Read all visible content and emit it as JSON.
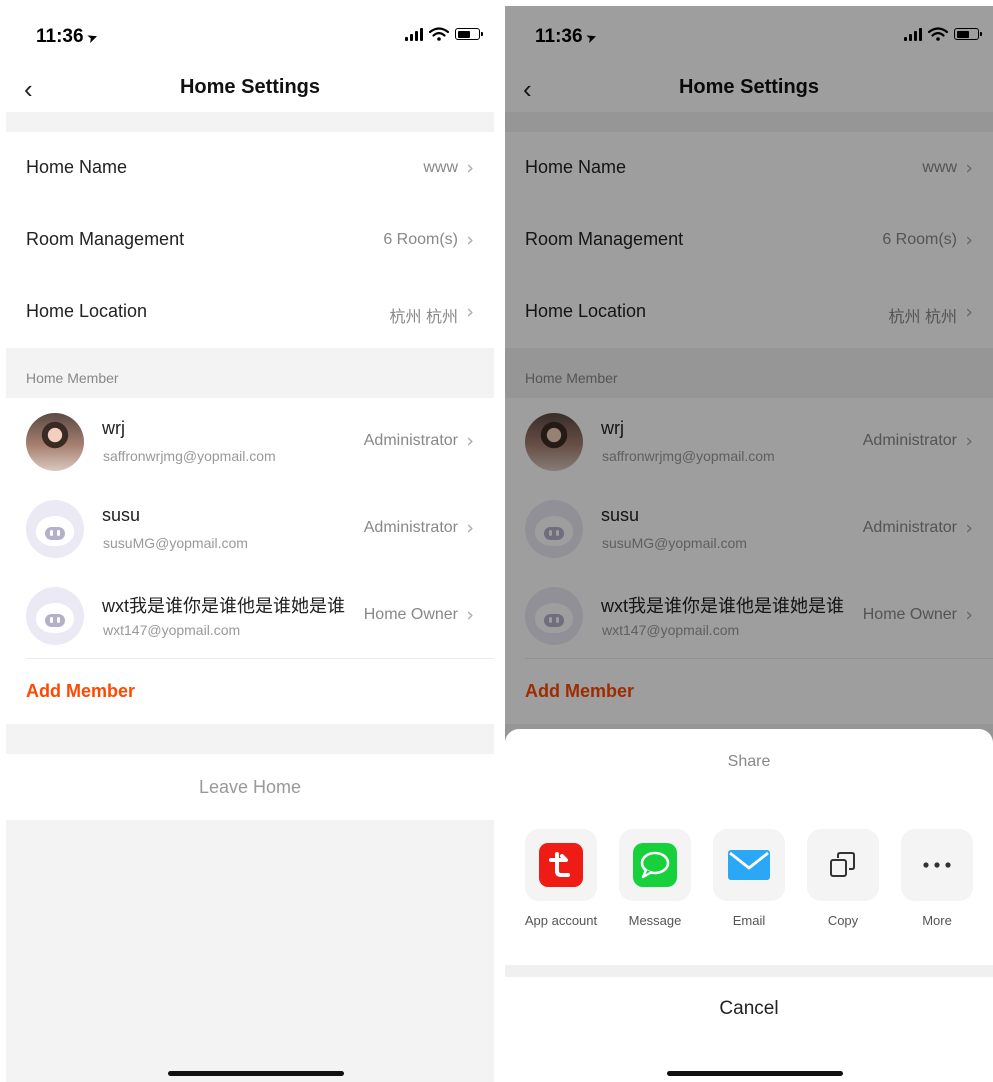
{
  "status_bar": {
    "time": "11:36",
    "location_arrow": "➤"
  },
  "nav": {
    "title": "Home Settings",
    "back_icon": "‹"
  },
  "settings": [
    {
      "label": "Home Name",
      "value": "www"
    },
    {
      "label": "Room Management",
      "value": "6 Room(s)"
    },
    {
      "label": "Home Location",
      "value": "杭州 杭州"
    }
  ],
  "chevron": "›",
  "members_section": {
    "header": "Home Member",
    "add_label": "Add Member"
  },
  "members": [
    {
      "name": "wrj",
      "email": "saffronwrjmg@yopmail.com",
      "role": "Administrator",
      "avatar": "photo"
    },
    {
      "name": "susu",
      "email": "susuMG@yopmail.com",
      "role": "Administrator",
      "avatar": "robot-icon"
    },
    {
      "name": "wxt我是谁你是谁他是谁她是谁",
      "email": "wxt147@yopmail.com",
      "role": "Home Owner",
      "avatar": "robot-icon"
    }
  ],
  "leave_label": "Leave Home",
  "share_sheet": {
    "title": "Share",
    "items": [
      {
        "label": "App account",
        "icon": "app-account-icon"
      },
      {
        "label": "Message",
        "icon": "message-icon"
      },
      {
        "label": "Email",
        "icon": "email-icon"
      },
      {
        "label": "Copy",
        "icon": "copy-icon"
      },
      {
        "label": "More",
        "icon": "more-icon"
      }
    ],
    "cancel_label": "Cancel"
  },
  "colors": {
    "accent": "#ff4800",
    "overlay": "rgba(0,0,0,0.38)",
    "app_icon_red": "#ee1c14",
    "message_green": "#17d13c",
    "email_blue": "#2aa7f5"
  }
}
